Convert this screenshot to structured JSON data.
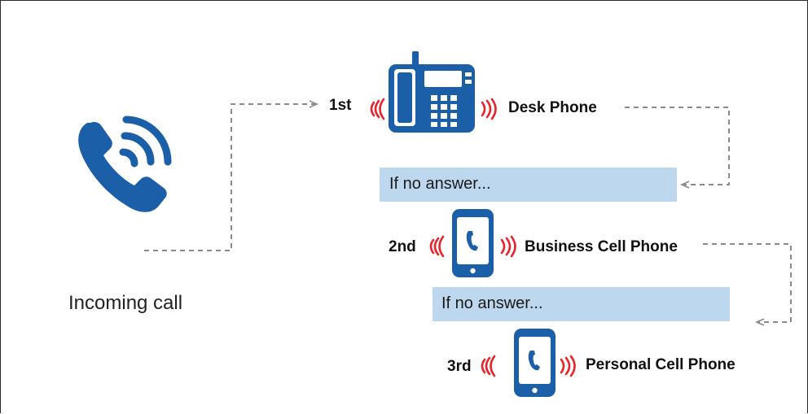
{
  "incoming": {
    "label": "Incoming call",
    "icon": "incoming-call-icon"
  },
  "steps": [
    {
      "order": "1st",
      "device": "Desk Phone",
      "icon": "desk-phone-icon"
    },
    {
      "order": "2nd",
      "device": "Business Cell Phone",
      "icon": "cell-phone-icon"
    },
    {
      "order": "3rd",
      "device": "Personal Cell Phone",
      "icon": "cell-phone-icon"
    }
  ],
  "fallback": [
    {
      "text": "If no answer..."
    },
    {
      "text": "If no answer..."
    }
  ],
  "colors": {
    "phone_blue": "#1b5fa8",
    "ring_red": "#e8242a",
    "band_blue": "#bdd7ee",
    "connector_gray": "#8a8a8a"
  }
}
